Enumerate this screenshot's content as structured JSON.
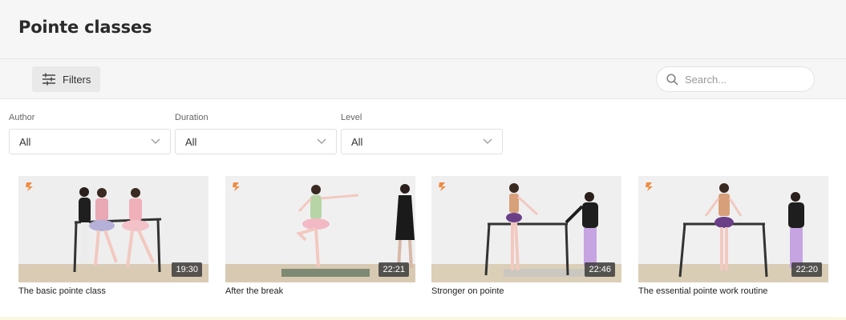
{
  "page": {
    "title": "Pointe classes"
  },
  "toolbar": {
    "filters_label": "Filters",
    "search_placeholder": "Search..."
  },
  "filters": [
    {
      "label": "Author",
      "value": "All"
    },
    {
      "label": "Duration",
      "value": "All"
    },
    {
      "label": "Level",
      "value": "All"
    }
  ],
  "cards": [
    {
      "title": "The basic pointe class",
      "duration": "19:30"
    },
    {
      "title": "After the break",
      "duration": "22:21"
    },
    {
      "title": "Stronger on pointe",
      "duration": "22:46"
    },
    {
      "title": "The essential pointe work routine",
      "duration": "22:20"
    }
  ],
  "colors": {
    "brand": "#f08a3e",
    "header_bg": "#f6f6f6"
  },
  "icons": {
    "filters": "sliders-icon",
    "search": "search-icon",
    "select": "chevron-down-icon",
    "brand": "brand-logo-icon"
  }
}
